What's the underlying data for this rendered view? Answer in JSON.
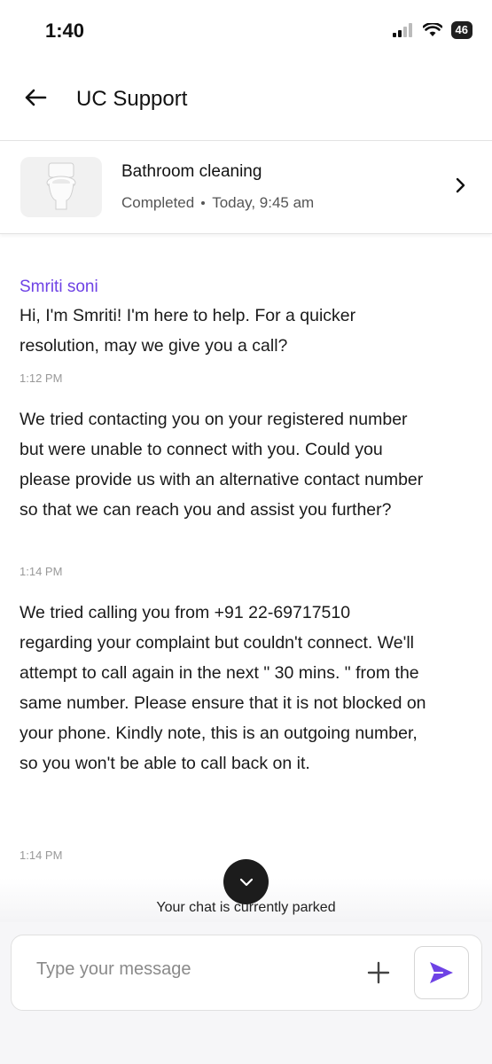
{
  "status_bar": {
    "time": "1:40",
    "battery": "46"
  },
  "header": {
    "title": "UC Support"
  },
  "booking": {
    "title": "Bathroom cleaning",
    "status": "Completed",
    "time": "Today, 9:45 am"
  },
  "chat": {
    "sender": "Smriti soni",
    "messages": [
      {
        "text": "Hi, I'm Smriti! I'm here to help. For a quicker resolution, may we give you a call?",
        "time": "1:12 PM"
      },
      {
        "text": "We tried contacting you on your registered number but were unable to connect with you. Could you please provide us with an alternative contact number so that we can reach you and assist you further?",
        "time": "1:14 PM"
      },
      {
        "text": "We tried calling you from +91 22-69717510 regarding your complaint but couldn't connect. We'll attempt to call again in the next \" 30 mins. \" from the same number. Please ensure that it is not blocked on your phone. Kindly note, this is an outgoing number, so you won't be able to call back on it.",
        "time": "1:14 PM"
      }
    ],
    "parked_notice": "Your chat is currently parked"
  },
  "composer": {
    "placeholder": "Type your message"
  },
  "colors": {
    "accent": "#6e42e5"
  }
}
